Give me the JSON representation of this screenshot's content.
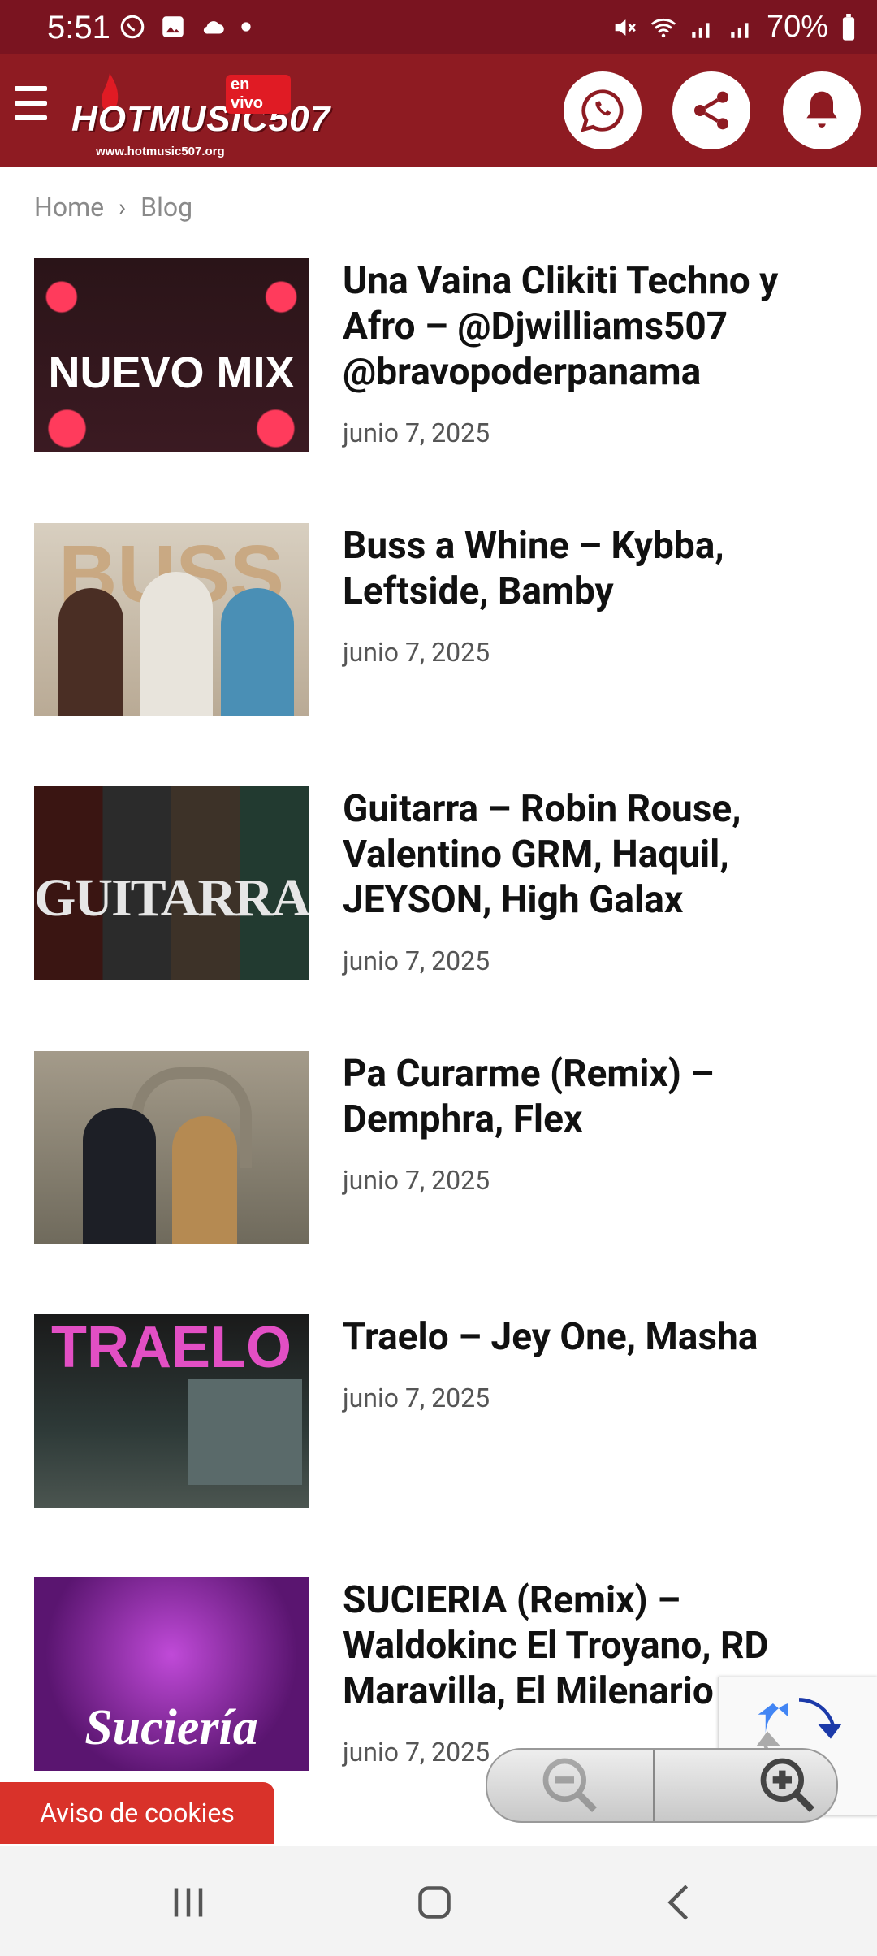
{
  "status_bar": {
    "time": "5:51",
    "battery": "70%"
  },
  "header": {
    "logo_text": "HOTMUSIC507",
    "logo_badge": "en vivo",
    "logo_url": "www.hotmusic507.org",
    "buttons": [
      "whatsapp-icon",
      "share-icon",
      "bell-icon"
    ]
  },
  "breadcrumb": {
    "home": "Home",
    "current": "Blog"
  },
  "posts": [
    {
      "title": "Una Vaina Clikiti Techno y Afro – @Djwilliams507 @bravopoderpanama",
      "date": "junio 7, 2025",
      "thumb_text": "NUEVO MIX"
    },
    {
      "title": "Buss a Whine – Kybba, Leftside, Bamby",
      "date": "junio 7, 2025",
      "thumb_text": "BUSS A"
    },
    {
      "title": "Guitarra – Robin Rouse, Valentino GRM, Haquil, JEYSON, High Galax",
      "date": "junio 7, 2025",
      "thumb_text": "GUITARRA"
    },
    {
      "title": "Pa Curarme (Remix) – Demphra, Flex",
      "date": "junio 7, 2025",
      "thumb_text": ""
    },
    {
      "title": "Traelo – Jey One, Masha",
      "date": "junio 7, 2025",
      "thumb_text": "TRAELO"
    },
    {
      "title": "SUCIERIA (Remix) – Waldokinc El Troyano, RD Maravilla, El Milenario",
      "date": "junio 7, 2025",
      "thumb_text": "Suciería"
    }
  ],
  "cookies_button": "Aviso de cookies",
  "colors": {
    "header_bg": "#8e1b22",
    "statusbar_bg": "#7a1420",
    "cookies_bg": "#d9322a"
  }
}
